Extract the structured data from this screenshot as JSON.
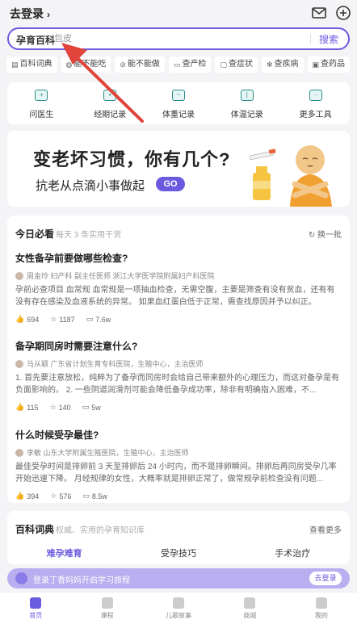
{
  "header": {
    "login_label": "去登录",
    "login_chevron": "›",
    "icons": [
      "mail-icon",
      "add-icon"
    ]
  },
  "search": {
    "scope": "孕育百科",
    "placeholder": "包皮",
    "button": "搜索"
  },
  "quick_tabs": [
    {
      "icon": "book-icon",
      "label": "百科词典"
    },
    {
      "icon": "food-icon",
      "label": "能不能吃"
    },
    {
      "icon": "no-icon",
      "label": "能不能做"
    },
    {
      "icon": "check-icon",
      "label": "查产检"
    },
    {
      "icon": "symptom-icon",
      "label": "查症状"
    },
    {
      "icon": "disease-icon",
      "label": "查疾病"
    },
    {
      "icon": "drug-icon",
      "label": "查药品"
    }
  ],
  "tools": [
    {
      "icon": "doctor-icon",
      "label": "问医生"
    },
    {
      "icon": "period-icon",
      "label": "经期记录"
    },
    {
      "icon": "weight-icon",
      "label": "体重记录"
    },
    {
      "icon": "temperature-icon",
      "label": "体温记录"
    },
    {
      "icon": "more-icon",
      "label": "更多工具"
    }
  ],
  "banner": {
    "title": "变老坏习惯，你有几个?",
    "subtitle": "抗老从点滴小事做起",
    "cta": "GO"
  },
  "must_read": {
    "title": "今日必看",
    "subtitle": "每天 3 条实用干货",
    "refresh": "换一批",
    "articles": [
      {
        "title": "女性备孕前要做哪些检查?",
        "author": "周金玲 妇产科 副主任医师 浙江大学医学院附属妇产科医院",
        "excerpt": "孕前必查项目 血常规 血常规是一项抽血检查，无需空腹，主要是筛查有没有贫血，还有有没有存在感染及血液系统的异常。 如果血红蛋白低于正常，需查找原因并予以纠正。",
        "likes": "694",
        "favorites": "1187",
        "views": "7.6w"
      },
      {
        "title": "备孕期同房时需要注意什么?",
        "author": "马从颖 广东省计划生育专科医院，生殖中心，主治医师",
        "excerpt": "1. 首先要注意放松，纯粹为了备孕而同房时会给自己带来额外的心理压力，而这对备孕是有负面影响的。 2. 一些阴道润滑剂可能会降低备孕成功率，除非有明确指入困难，不...",
        "likes": "115",
        "favorites": "140",
        "views": "5w"
      },
      {
        "title": "什么时候受孕最佳?",
        "author": "李敏 山东大学附属生殖医院，生殖中心，主治医师",
        "excerpt": "最佳受孕时间是排卵前 3 天至排卵后 24 小时内，而不是排卵瞬间。排卵后再同房受孕几率开始迅速下降。 月经规律的女性，大概率就是排卵正常了，做常规孕前检查没有问题...",
        "likes": "394",
        "favorites": "576",
        "views": "8.5w"
      }
    ]
  },
  "encyclopedia": {
    "title": "百科词典",
    "subtitle": "权威、实用的孕育知识库",
    "more": "查看更多",
    "tabs": [
      "难孕难育",
      "受孕技巧",
      "手术治疗"
    ]
  },
  "login_prompt": {
    "text": "登录丁香妈妈开启学习旅程",
    "button": "去登录"
  },
  "tabbar": [
    "首页",
    "课程",
    "儿歌故事",
    "商城",
    "我的"
  ],
  "colors": {
    "accent": "#6a5ae0",
    "annotation_arrow": "#e0443a"
  }
}
